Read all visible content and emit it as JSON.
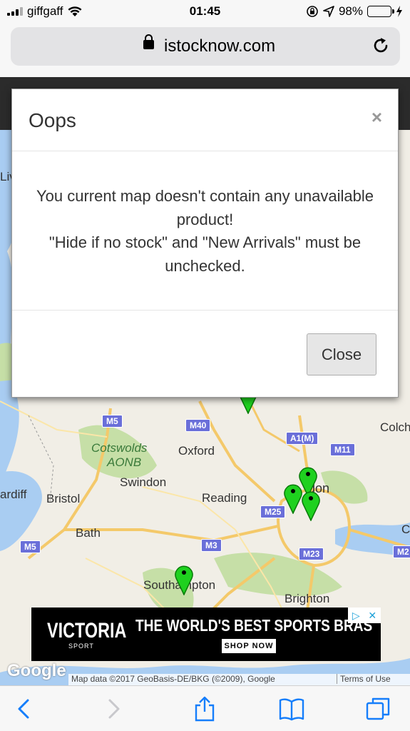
{
  "status_bar": {
    "carrier": "giffgaff",
    "time": "01:45",
    "battery": "98%",
    "battery_level": 0.98
  },
  "browser": {
    "url": "istocknow.com"
  },
  "map": {
    "places": [
      {
        "name": "Cotswolds",
        "style": "green"
      },
      {
        "name": "AONB",
        "style": "green"
      },
      {
        "name": "Oxford",
        "style": "city"
      },
      {
        "name": "Swindon",
        "style": "city"
      },
      {
        "name": "ardiff",
        "style": "city"
      },
      {
        "name": "Bristol",
        "style": "city"
      },
      {
        "name": "Reading",
        "style": "city"
      },
      {
        "name": "Bath",
        "style": "city"
      },
      {
        "name": "don",
        "style": "city"
      },
      {
        "name": "Southampton",
        "style": "city"
      },
      {
        "name": "Brighton",
        "style": "city"
      },
      {
        "name": "Colch",
        "style": "city"
      },
      {
        "name": "Liv",
        "style": "city"
      }
    ],
    "roads": [
      "M5",
      "M40",
      "A1(M)",
      "M11",
      "M25",
      "M3",
      "M23",
      "M5",
      "M2",
      "C"
    ],
    "google_logo": "Google",
    "attribution": "Map data ©2017 GeoBasis-DE/BKG (©2009), Google",
    "terms": "Terms of Use",
    "colors": {
      "water": "#a9cdf2",
      "land": "#f1eee6",
      "park": "#c6dfa7",
      "motorway": "#f4c96a",
      "marker": "#1fd11f"
    }
  },
  "ad": {
    "brand": "VICTORIA",
    "brand_sub": "SPORT",
    "headline": "THE WORLD'S BEST SPORTS BRAS",
    "cta": "SHOP NOW"
  },
  "modal": {
    "title": "Oops",
    "close_x": "×",
    "body_line1": "You current map doesn't contain any unavailable product!",
    "body_line2": "\"Hide if no stock\" and \"New Arrivals\" must be unchecked.",
    "close_button": "Close"
  },
  "toolbar": {
    "icons": [
      "back-icon",
      "forward-icon",
      "share-icon",
      "bookmarks-icon",
      "tabs-icon"
    ]
  }
}
